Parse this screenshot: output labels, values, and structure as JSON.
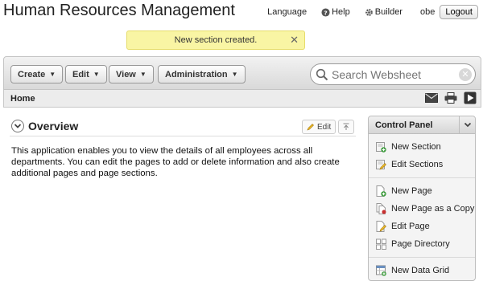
{
  "app": {
    "title": "Human Resources Management"
  },
  "topnav": {
    "language": "Language",
    "help": "Help",
    "builder": "Builder",
    "user": "obe",
    "logout": "Logout"
  },
  "notice": {
    "message": "New section created.",
    "close_glyph": "✕"
  },
  "toolbar": {
    "menus": [
      {
        "label": "Create"
      },
      {
        "label": "Edit"
      },
      {
        "label": "View"
      },
      {
        "label": "Administration"
      }
    ],
    "search": {
      "placeholder": "Search Websheet",
      "value": ""
    }
  },
  "breadcrumb": {
    "current": "Home"
  },
  "section": {
    "title": "Overview",
    "edit_label": "Edit",
    "body": "This application enables you to view the details of all employees across all departments. You can edit the pages to add or delete information and also create additional pages and page sections."
  },
  "control_panel": {
    "title": "Control Panel",
    "groups": [
      {
        "items": [
          {
            "label": "New Section",
            "icon": "new-section-icon"
          },
          {
            "label": "Edit Sections",
            "icon": "edit-sections-icon"
          }
        ]
      },
      {
        "items": [
          {
            "label": "New Page",
            "icon": "new-page-icon"
          },
          {
            "label": "New Page as a Copy",
            "icon": "copy-page-icon"
          },
          {
            "label": "Edit Page",
            "icon": "edit-page-icon"
          },
          {
            "label": "Page Directory",
            "icon": "page-directory-icon"
          }
        ]
      },
      {
        "items": [
          {
            "label": "New Data Grid",
            "icon": "data-grid-icon"
          }
        ]
      }
    ]
  },
  "colors": {
    "notice_bg": "#f9f5a4",
    "toolbar_bg": "#e6e6e6",
    "accent_green": "#3a9a3a"
  }
}
